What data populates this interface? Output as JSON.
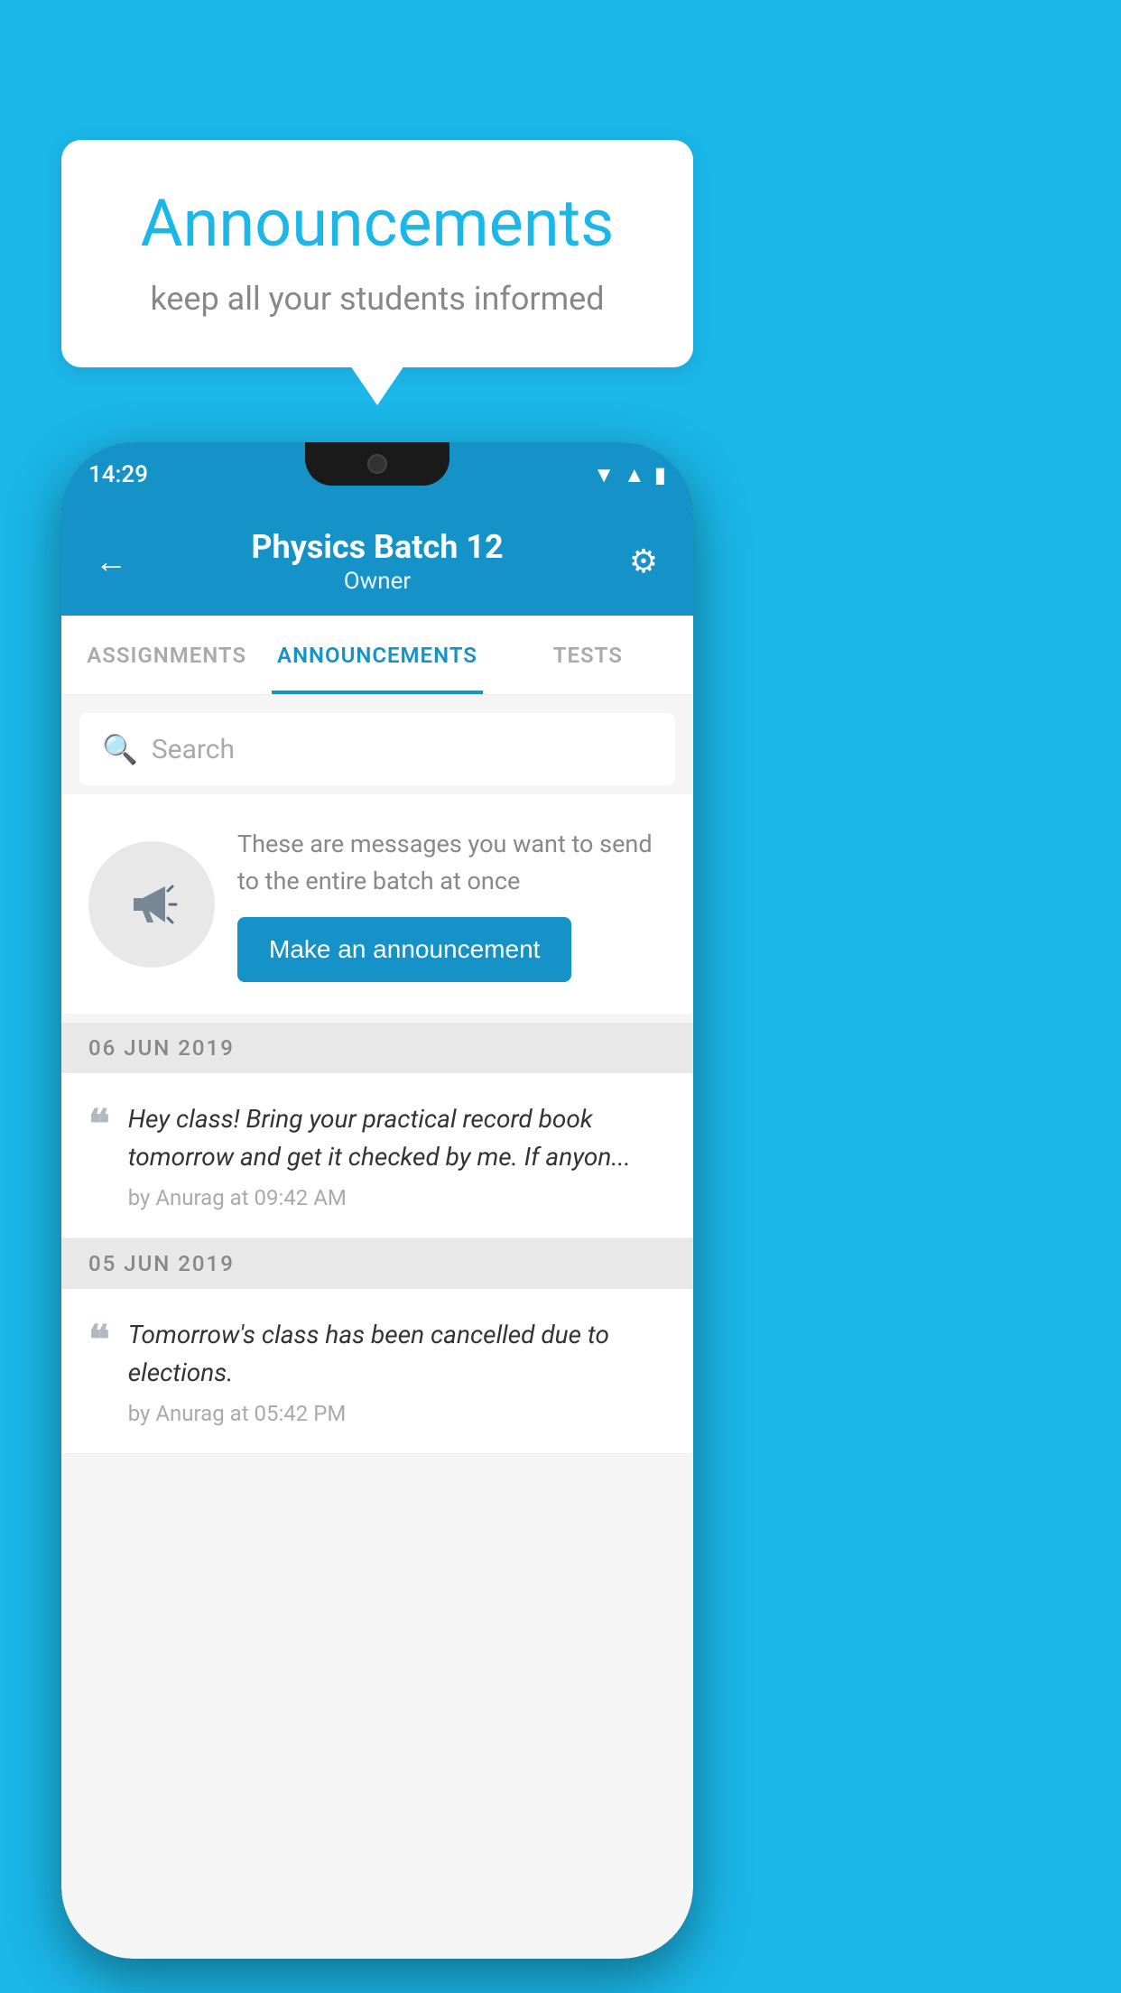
{
  "background_color": "#1ab7e8",
  "speech_bubble": {
    "title": "Announcements",
    "subtitle": "keep all your students informed"
  },
  "phone": {
    "status_bar": {
      "time": "14:29",
      "icons": [
        "wifi",
        "signal",
        "battery"
      ]
    },
    "header": {
      "back_label": "←",
      "title": "Physics Batch 12",
      "subtitle": "Owner",
      "gear_label": "⚙"
    },
    "tabs": [
      {
        "label": "ASSIGNMENTS",
        "active": false
      },
      {
        "label": "ANNOUNCEMENTS",
        "active": true
      },
      {
        "label": "TESTS",
        "active": false
      }
    ],
    "search": {
      "placeholder": "Search"
    },
    "promo": {
      "description": "These are messages you want to send to the entire batch at once",
      "button_label": "Make an announcement"
    },
    "announcements": [
      {
        "date": "06  JUN  2019",
        "message": "Hey class! Bring your practical record book tomorrow and get it checked by me. If anyon...",
        "meta": "by Anurag at 09:42 AM"
      },
      {
        "date": "05  JUN  2019",
        "message": "Tomorrow's class has been cancelled due to elections.",
        "meta": "by Anurag at 05:42 PM"
      }
    ]
  }
}
